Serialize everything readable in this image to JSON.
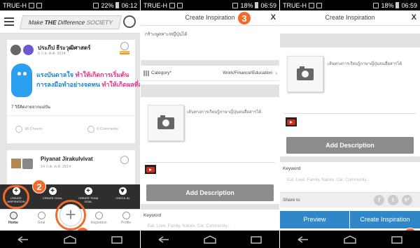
{
  "status_left": {
    "carrier": "TRUE-H",
    "p1_time": "06:12",
    "p1_battery": "22%",
    "p2_time": "06:59",
    "p2_battery": "18%",
    "p3_time": "06:59",
    "p3_battery": "18%"
  },
  "panel1": {
    "brand": {
      "prefix": "Make",
      "bold": "THE",
      "suffix": "Difference",
      "society": "SOCIETY"
    },
    "card1": {
      "name": "ประภีป ธีระวุฒิศาสตร์",
      "date": "6 ก.ย. ค.ศ. 2014",
      "badge": "INSPIRATION",
      "banner_line1_blue": "แรงบันดาลใจ",
      "banner_line1_pink": "ทำให้เกิดการเริ่มต้น",
      "banner_line2_blue": "การลงมือทำอย่างจดทน",
      "banner_line2_pink": "ทำให้เกิดผลที่สำ",
      "caption": "7 วิธีคิดง่ายจากแม่ปัน",
      "cheers": "38 Cheers",
      "comments": "0 Comments"
    },
    "card2": {
      "name": "Piyanat Jirakulvivat",
      "date": "14 ก.ค. ค.ศ. 2014"
    },
    "quick_actions": [
      {
        "icon": "+",
        "label": "CREATE INSPIRATION"
      },
      {
        "icon": "+",
        "label": "CREATE GOAL"
      },
      {
        "icon": "+",
        "label": "CREATE TEAM GOAL"
      },
      {
        "icon": "♥",
        "label": "CHECK-IN"
      }
    ],
    "tabs": [
      "Home",
      "Goal",
      "",
      "Inspiration",
      "Profile"
    ],
    "fab": "+",
    "callout_1": "1",
    "callout_2": "2"
  },
  "panel2": {
    "title": "Create Inspiration",
    "close": "X",
    "callout_3": "3",
    "title_input": "กรัาะพูดหาะหญี่ปุ่นได้",
    "category_label": "Category*",
    "category_value": "Work/Finance/Education",
    "photo_desc": "เส้นทางการเรียนรู้ภาษาญี่ปุ่นจนสื่อสารได้",
    "add_description": "Add Description",
    "keyword_label": "Keyword",
    "keyword_placeholder": "Eat, Love, Family, Nature, Car, Community..."
  },
  "panel3": {
    "title": "Create Inspiration",
    "close": "X",
    "photo_desc": "เส้นทางการเรียนรู้ภาษาญี่ปุ่นจนสื่อสารได้",
    "add_description": "Add Description",
    "keyword_label": "Keyword",
    "keyword_placeholder": "Eat, Love, Family, Nature, Car, Community...",
    "share_label": "Share to",
    "share_icons": [
      "f",
      "t",
      "g+"
    ],
    "preview": "Preview",
    "create": "Create Inspiration",
    "callout_4": "4"
  },
  "colors": {
    "accent": "#f26a2a",
    "primary": "#2f86c8"
  }
}
